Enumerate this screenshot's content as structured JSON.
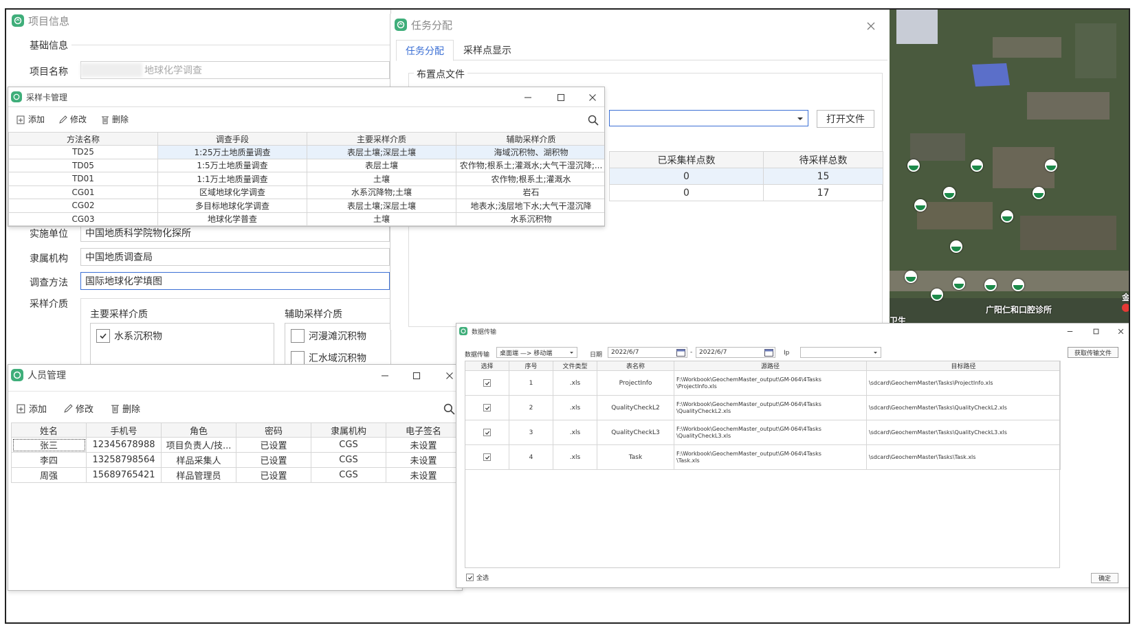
{
  "project_window": {
    "title": "项目信息",
    "section": "基础信息",
    "name_label": "项目名称",
    "name_value": "地球化学调查",
    "unit_label": "实施单位",
    "unit_value": "中国地质科学院物化探所",
    "org_label": "隶属机构",
    "org_value": "中国地质调查局",
    "method_label": "调查方法",
    "method_value": "国际地球化学填图",
    "media_label": "采样介质",
    "main_media_label": "主要采样介质",
    "aux_media_label": "辅助采样介质",
    "main_media": [
      {
        "label": "水系沉积物",
        "checked": true
      }
    ],
    "aux_media": [
      {
        "label": "河漫滩沉积物",
        "checked": false
      },
      {
        "label": "汇水域沉积物",
        "checked": false
      }
    ]
  },
  "task_window": {
    "title": "任务分配",
    "tabs": [
      "任务分配",
      "采样点显示"
    ],
    "active_tab": 0,
    "file_group": "布置点文件",
    "open_button": "打开文件",
    "headers": [
      "已采集样点数",
      "待采样总数"
    ],
    "rows": [
      [
        "0",
        "15"
      ],
      [
        "0",
        "17"
      ]
    ]
  },
  "card_window": {
    "title": "采样卡管理",
    "toolbar": {
      "add": "添加",
      "edit": "修改",
      "delete": "删除"
    },
    "headers": [
      "方法名称",
      "调查手段",
      "主要采样介质",
      "辅助采样介质"
    ],
    "rows": [
      [
        "TD25",
        "1:25万土地质量调查",
        "表层土壤;深层土壤",
        "海域沉积物、湖积物"
      ],
      [
        "TD05",
        "1:5万土地质量调查",
        "表层土壤",
        "农作物;根系土;灌溉水;大气干湿沉降;..."
      ],
      [
        "TD01",
        "1:1万土地质量调查",
        "土壤",
        "农作物;根系土;灌溉水"
      ],
      [
        "CG01",
        "区域地球化学调查",
        "水系沉降物;土壤",
        "岩石"
      ],
      [
        "CG02",
        "多目标地球化学调查",
        "表层土壤;深层土壤",
        "地表水;浅层地下水;大气干湿沉降"
      ],
      [
        "CG03",
        "地球化学普查",
        "土壤",
        "水系沉积物"
      ]
    ]
  },
  "staff_window": {
    "title": "人员管理",
    "toolbar": {
      "add": "添加",
      "edit": "修改",
      "delete": "删除"
    },
    "headers": [
      "姓名",
      "手机号",
      "角色",
      "密码",
      "隶属机构",
      "电子签名"
    ],
    "rows": [
      [
        "张三",
        "12345678988",
        "项目负责人/技...",
        "已设置",
        "CGS",
        "未设置"
      ],
      [
        "李四",
        "13258798564",
        "样品采集人",
        "已设置",
        "CGS",
        "未设置"
      ],
      [
        "周强",
        "15689765421",
        "样品管理员",
        "已设置",
        "CGS",
        "未设置"
      ]
    ]
  },
  "map": {
    "label_clinic": "广阳仁和口腔诊所",
    "label_partial_1": "卫生",
    "label_partial_2": "金"
  },
  "transfer_window": {
    "title": "数据传输",
    "mode_label": "数据传输",
    "mode_value": "桌面端 —> 移动端",
    "date_label": "日期",
    "date_from": "2022/6/7",
    "date_sep": "-",
    "date_to": "2022/6/7",
    "ip_label": "Ip",
    "fetch_button": "获取传输文件",
    "headers": [
      "选择",
      "序号",
      "文件类型",
      "表名称",
      "源路径",
      "目标路径"
    ],
    "rows": [
      {
        "checked": true,
        "no": "1",
        "type": ".xls",
        "name": "ProjectInfo",
        "src1": "F:\\Workbook\\GeochemMaster_output\\GM-064\\4Tasks",
        "src2": "\\ProjectInfo.xls",
        "dst": "\\sdcard\\GeochemMaster\\Tasks\\ProjectInfo.xls"
      },
      {
        "checked": true,
        "no": "2",
        "type": ".xls",
        "name": "QualityCheckL2",
        "src1": "F:\\Workbook\\GeochemMaster_output\\GM-064\\4Tasks",
        "src2": "\\QualityCheckL2.xls",
        "dst": "\\sdcard\\GeochemMaster\\Tasks\\QualityCheckL2.xls"
      },
      {
        "checked": true,
        "no": "3",
        "type": ".xls",
        "name": "QualityCheckL3",
        "src1": "F:\\Workbook\\GeochemMaster_output\\GM-064\\4Tasks",
        "src2": "\\QualityCheckL3.xls",
        "dst": "\\sdcard\\GeochemMaster\\Tasks\\QualityCheckL3.xls"
      },
      {
        "checked": true,
        "no": "4",
        "type": ".xls",
        "name": "Task",
        "src1": "F:\\Workbook\\GeochemMaster_output\\GM-064\\4Tasks",
        "src2": "\\Task.xls",
        "dst": "\\sdcard\\GeochemMaster\\Tasks\\Task.xls"
      }
    ],
    "select_all": "全选",
    "ok_button": "确定"
  },
  "colors": {
    "accent": "#3b6fd4",
    "icon_green": "#3fae7a",
    "map_marker": "#1c8a4a"
  }
}
